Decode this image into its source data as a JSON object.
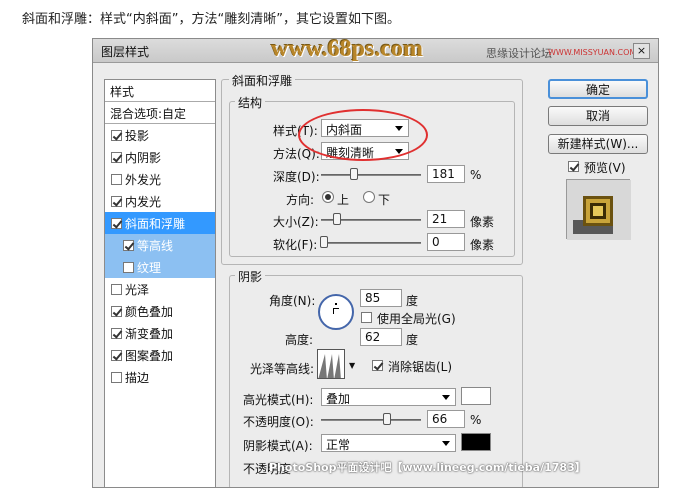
{
  "caption": "斜面和浮雕：样式“内斜面”，方法“雕刻清晰”，其它设置如下图。",
  "dialog": {
    "title": "图层样式",
    "watermark": "www.68ps.com",
    "watermark2": "思缘设计论坛",
    "watermark3": "WWW.MISSYUAN.COM",
    "close": "×",
    "footer_watermark": "PhotoShop平面设计吧【www.lineeg.com/tieba/1783】"
  },
  "left_panel": {
    "header": "样式",
    "blend": "混合选项:自定",
    "items": [
      {
        "label": "投影",
        "checked": true
      },
      {
        "label": "内阴影",
        "checked": true
      },
      {
        "label": "外发光",
        "checked": false
      },
      {
        "label": "内发光",
        "checked": true
      },
      {
        "label": "斜面和浮雕",
        "checked": true,
        "selected": true
      },
      {
        "label": "等高线",
        "checked": true,
        "sub": true
      },
      {
        "label": "纹理",
        "checked": false,
        "sub": true
      },
      {
        "label": "光泽",
        "checked": false
      },
      {
        "label": "颜色叠加",
        "checked": true
      },
      {
        "label": "渐变叠加",
        "checked": true
      },
      {
        "label": "图案叠加",
        "checked": true
      },
      {
        "label": "描边",
        "checked": false
      }
    ]
  },
  "bevel": {
    "group_title": "斜面和浮雕",
    "structure_title": "结构",
    "style_label": "样式(T):",
    "style_value": "内斜面",
    "technique_label": "方法(Q):",
    "technique_value": "雕刻清晰",
    "depth_label": "深度(D):",
    "depth_value": "181",
    "depth_unit": "%",
    "direction_label": "方向:",
    "dir_up": "上",
    "dir_down": "下",
    "size_label": "大小(Z):",
    "size_value": "21",
    "size_unit": "像素",
    "soften_label": "软化(F):",
    "soften_value": "0",
    "soften_unit": "像素"
  },
  "shading": {
    "title": "阴影",
    "angle_label": "角度(N):",
    "angle_value": "85",
    "angle_unit": "度",
    "global_light": "使用全局光(G)",
    "altitude_label": "高度:",
    "altitude_value": "62",
    "altitude_unit": "度",
    "gloss_label": "光泽等高线:",
    "antialias": "消除锯齿(L)",
    "highlight_label": "高光模式(H):",
    "highlight_value": "叠加",
    "highlight_color": "#ffffff",
    "h_opacity_label": "不透明度(O):",
    "h_opacity_value": "66",
    "h_opacity_unit": "%",
    "shadow_label": "阴影模式(A):",
    "shadow_value": "正常",
    "shadow_color": "#000000",
    "s_opacity_label": "不透明度"
  },
  "right": {
    "ok": "确定",
    "cancel": "取消",
    "new_style": "新建样式(W)...",
    "preview": "预览(V)"
  }
}
